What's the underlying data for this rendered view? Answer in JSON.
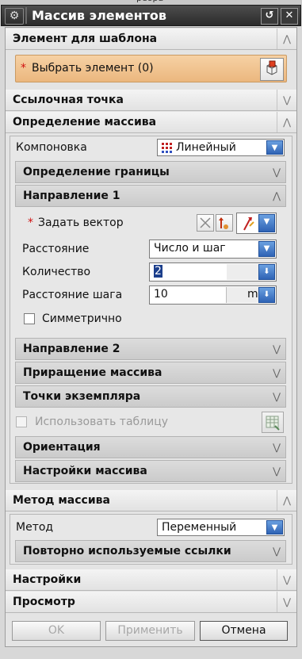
{
  "top_strip_text": "peopa",
  "window": {
    "title": "Массив элементов",
    "gear_icon": "gear-icon",
    "reset_icon": "reset-icon",
    "close_icon": "close-icon"
  },
  "template_element": {
    "header": "Элемент для шаблона",
    "required_mark": "*",
    "select_label": "Выбрать элемент (0)",
    "select_icon": "select-object-icon",
    "accent_color": "#f0c89a"
  },
  "reference_point": {
    "header": "Ссылочная точка"
  },
  "array_definition": {
    "header": "Определение массива",
    "layout_label": "Компоновка",
    "layout_value": "Линейный",
    "boundary_header": "Определение границы",
    "direction1": {
      "header": "Направление 1",
      "required_mark": "*",
      "vector_label": "Задать вектор",
      "distance_label": "Расстояние",
      "distance_value": "Число и шаг",
      "count_label": "Количество",
      "count_value": "2",
      "pitch_label": "Расстояние шага",
      "pitch_value": "10",
      "pitch_unit": "mm",
      "symmetric_label": "Симметрично",
      "symmetric_checked": false
    },
    "direction2_header": "Направление 2",
    "increment_header": "Приращение массива",
    "instance_points_header": "Точки экземпляра",
    "use_table_label": "Использовать таблицу",
    "orientation_header": "Ориентация",
    "array_settings_header": "Настройки массива"
  },
  "array_method": {
    "header": "Метод массива",
    "method_label": "Метод",
    "method_value": "Переменный",
    "reuse_refs_header": "Повторно используемые ссылки"
  },
  "settings": {
    "header": "Настройки"
  },
  "preview": {
    "header": "Просмотр"
  },
  "footer": {
    "ok": "OK",
    "apply": "Применить",
    "cancel": "Отмена"
  }
}
